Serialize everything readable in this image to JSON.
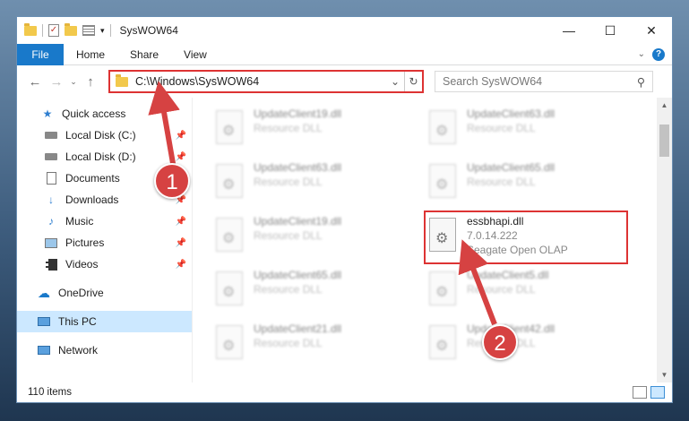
{
  "window": {
    "title": "SysWOW64"
  },
  "controls": {
    "minimize": "—",
    "maximize": "☐",
    "close": "✕"
  },
  "ribbon": {
    "file": "File",
    "tabs": [
      "Home",
      "Share",
      "View"
    ]
  },
  "address": {
    "path": "C:\\Windows\\SysWOW64"
  },
  "search": {
    "placeholder": "Search SysWOW64"
  },
  "sidebar": {
    "items": [
      {
        "label": "Quick access",
        "icon": "star-icon"
      },
      {
        "label": "Local Disk (C:)",
        "icon": "drive-icon",
        "pinned": true
      },
      {
        "label": "Local Disk (D:)",
        "icon": "drive-icon",
        "pinned": true
      },
      {
        "label": "Documents",
        "icon": "documents-icon",
        "pinned": true
      },
      {
        "label": "Downloads",
        "icon": "download-icon",
        "pinned": true
      },
      {
        "label": "Music",
        "icon": "music-icon",
        "pinned": true
      },
      {
        "label": "Pictures",
        "icon": "pictures-icon",
        "pinned": true
      },
      {
        "label": "Videos",
        "icon": "videos-icon",
        "pinned": true
      },
      {
        "label": "OneDrive",
        "icon": "cloud-icon"
      },
      {
        "label": "This PC",
        "icon": "computer-icon",
        "selected": true
      },
      {
        "label": "Network",
        "icon": "network-icon"
      }
    ]
  },
  "files": [
    {
      "name": "UpdateClient19.dll",
      "type": "Resource DLL"
    },
    {
      "name": "UpdateClient63.dll",
      "type": "Resource DLL"
    },
    {
      "name": "UpdateClient63.dll",
      "type": "Resource DLL"
    },
    {
      "name": "UpdateClient65.dll",
      "type": "Resource DLL"
    },
    {
      "name": "UpdateClient19.dll",
      "type": "Resource DLL"
    },
    {
      "name": "essbhapi.dll",
      "version": "7.0.14.222",
      "type": "Seagate Open OLAP"
    },
    {
      "name": "UpdateClient65.dll",
      "type": "Resource DLL"
    },
    {
      "name": "UpdateClient5.dll",
      "type": "Resource DLL"
    },
    {
      "name": "UpdateClient21.dll",
      "type": "Resource DLL"
    },
    {
      "name": "UpdateClient42.dll",
      "type": "Resource DLL"
    }
  ],
  "status": {
    "items": "110 items"
  },
  "callouts": [
    "1",
    "2"
  ],
  "colors": {
    "accent": "#1979ca",
    "highlight": "#d33333",
    "callout": "#d64242"
  }
}
